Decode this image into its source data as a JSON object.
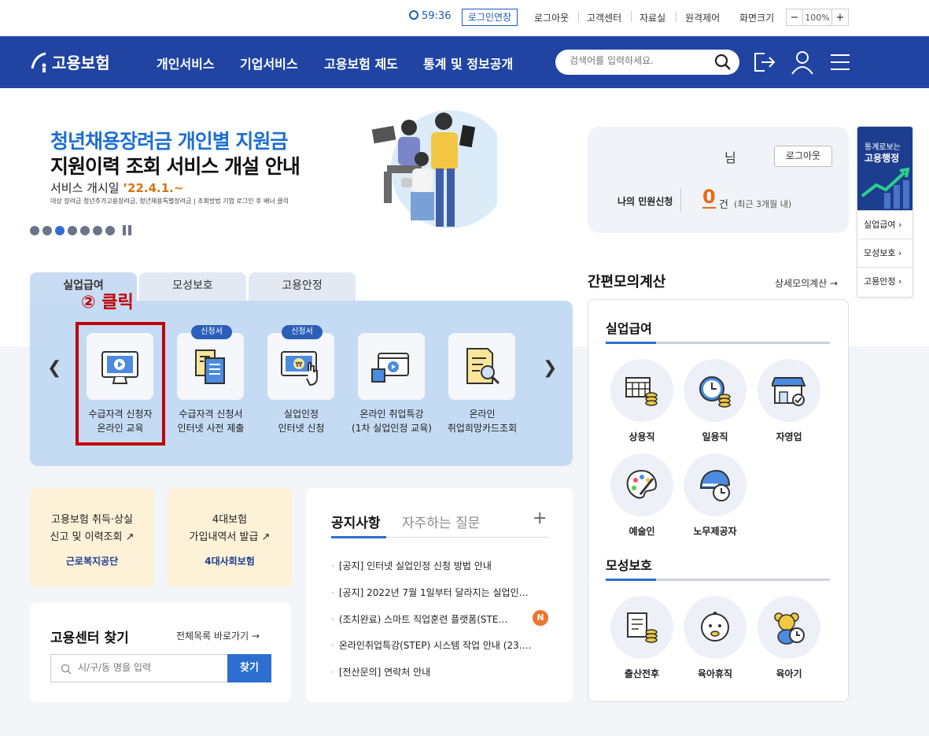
{
  "util": {
    "timer": "59:36",
    "extend": "로그인연장",
    "links": [
      "로그아웃",
      "고객센터",
      "자료실",
      "원격제어"
    ],
    "zoom_label": "화면크기",
    "zoom_minus": "−",
    "zoom_value": "100%",
    "zoom_plus": "+"
  },
  "header": {
    "logo": "고용보험",
    "nav": [
      "개인서비스",
      "기업서비스",
      "고용보험 제도",
      "통계 및 정보공개"
    ],
    "search_placeholder": "검색어를 입력하세요."
  },
  "hero": {
    "title_line1": "청년채용장려금 개인별 지원금",
    "title_line2": "지원이력 조회 서비스 개설 안내",
    "sub_prefix": "서비스 개시일 ",
    "sub_date": "’22.4.1.~",
    "small": "대상 장려금 청년추가고용장려금, 청년채용특별장려금 | 조회방법 기업 로그인 후 배너 클릭"
  },
  "login_panel": {
    "user_suffix": "님",
    "logout": "로그아웃",
    "my_label": "나의 민원신청",
    "count": "0",
    "unit": "건",
    "period": "(최근 3개월 내)"
  },
  "quick": {
    "top_line1": "통계로보는",
    "top_line2": "고용행정",
    "items": [
      "실업급여 ›",
      "모성보호 ›",
      "고용안정 ›"
    ]
  },
  "benefit": {
    "tabs": [
      "실업급여",
      "모성보호",
      "고용안정"
    ],
    "annotation": "② 클릭",
    "badge": "신청서",
    "services": [
      {
        "line1": "수급자격 신청자",
        "line2": "온라인 교육"
      },
      {
        "line1": "수급자격 신청서",
        "line2": "인터넷 사전 제출"
      },
      {
        "line1": "실업인정",
        "line2": "인터넷 신청"
      },
      {
        "line1": "온라인 취업특강",
        "line2": "(1차 실업인정 교육)"
      },
      {
        "line1": "온라인",
        "line2": "취업희망카드조회"
      }
    ]
  },
  "calc": {
    "title": "간편모의계산",
    "more": "상세모의계산 →",
    "section1": "실업급여",
    "section1_items": [
      "상용직",
      "일용직",
      "자영업",
      "예술인",
      "노무제공자"
    ],
    "section2": "모성보호",
    "section2_items": [
      "출산전후",
      "육아휴직",
      "육아기"
    ]
  },
  "cards": {
    "card1_line1": "고용보험 취득·상실",
    "card1_line2": "신고 및 이력조회",
    "card1_org": "근로복지공단",
    "card2_line1": "4대보험",
    "card2_line2": "가입내역서 발급",
    "card2_org": "4대사회보험"
  },
  "notice": {
    "tab_active": "공지사항",
    "tab_inactive": "자주하는 질문",
    "plus": "+",
    "new_badge": "N",
    "items": [
      "[공지] 인터넷 실업인정 신청 방법 안내",
      "[공지] 2022년 7월 1일부터 달라지는 실업인…",
      "(조치완료) 스마트 직업훈련 플랫폼(STE…",
      "온라인취업특강(STEP) 시스템 작업 안내 (23.…",
      "[전산문의] 연락처 안내"
    ]
  },
  "center": {
    "title": "고용센터 찾기",
    "more": "전체목록 바로가기 →",
    "placeholder": "시/구/동 명을 입력",
    "button": "찾기"
  }
}
